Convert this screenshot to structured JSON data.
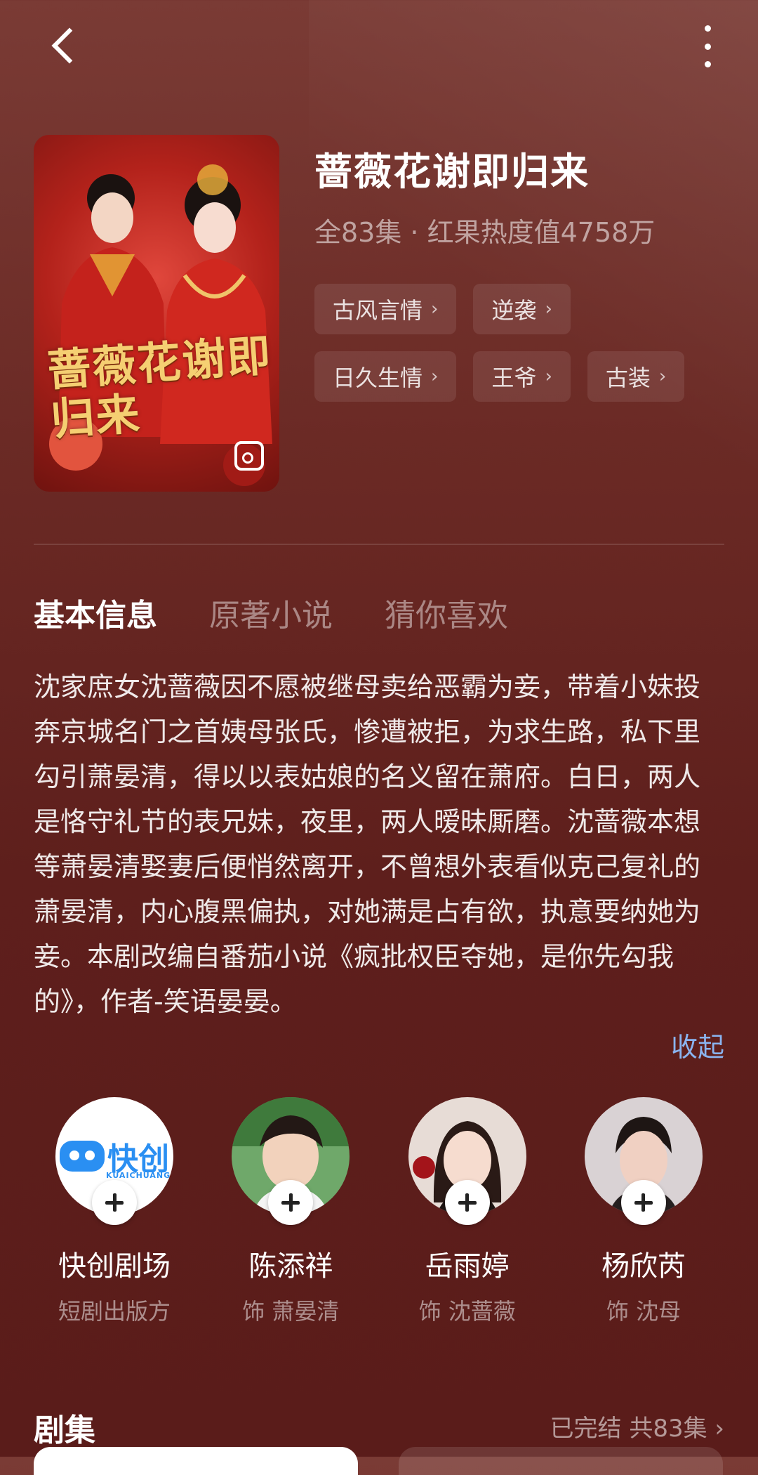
{
  "drama": {
    "title": "蔷薇花谢即归来",
    "meta": "全83集 · 红果热度值4758万",
    "poster_title": "蔷薇花谢即归来"
  },
  "tags": [
    {
      "label": "古风言情"
    },
    {
      "label": "逆袭"
    },
    {
      "label": "日久生情"
    },
    {
      "label": "王爷"
    },
    {
      "label": "古装"
    }
  ],
  "tabs": [
    "基本信息",
    "原著小说",
    "猜你喜欢"
  ],
  "description": "沈家庶女沈蔷薇因不愿被继母卖给恶霸为妾，带着小妹投奔京城名门之首姨母张氏，惨遭被拒，为求生路，私下里勾引萧晏清，得以以表姑娘的名义留在萧府。白日，两人是恪守礼节的表兄妹，夜里，两人暧昧厮磨。沈蔷薇本想等萧晏清娶妻后便悄然离开，不曾想外表看似克己复礼的萧晏清，内心腹黑偏执，对她满是占有欲，执意要纳她为妾。本剧改编自番茄小说《疯批权臣夺她，是你先勾我的》，作者-笑语晏晏。",
  "collapse_label": "收起",
  "cast": [
    {
      "name": "快创剧场",
      "role": "短剧出版方",
      "logo_text": "快创",
      "logo_sub": "KUAICHUANG"
    },
    {
      "name": "陈添祥",
      "role": "饰 萧晏清"
    },
    {
      "name": "岳雨婷",
      "role": "饰 沈蔷薇"
    },
    {
      "name": "杨欣芮",
      "role": "饰 沈母"
    }
  ],
  "episodes": {
    "title": "剧集",
    "status": "已完结 共83集 ›"
  },
  "icons": {
    "back": "chevron-left-icon",
    "more": "more-vertical-icon",
    "follow": "plus-icon",
    "chevron": "chevron-right-icon"
  },
  "colors": {
    "accent_link": "#8ab4f0",
    "logo_blue": "#2a8ff2"
  }
}
